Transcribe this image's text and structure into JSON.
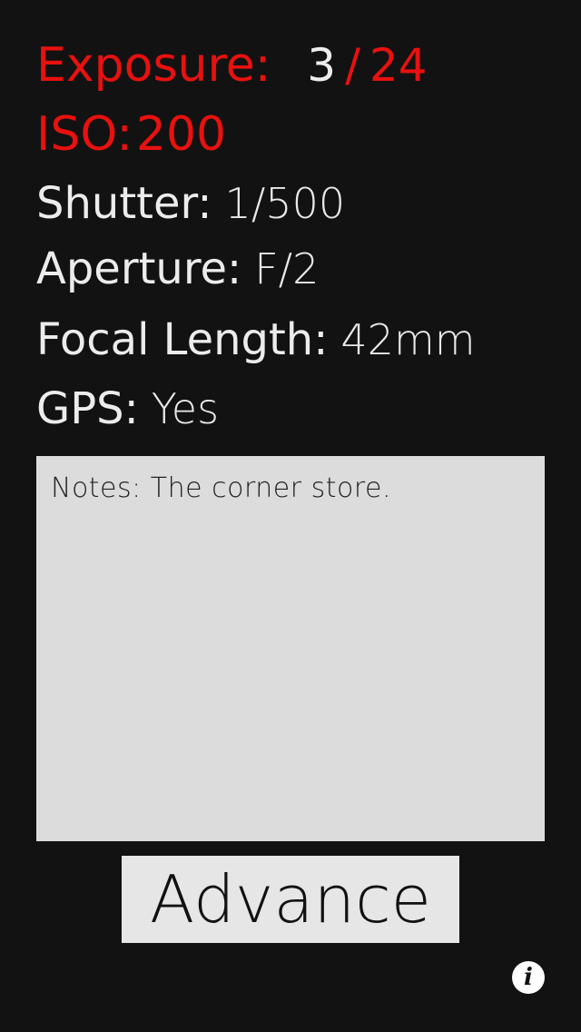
{
  "exposure": {
    "label": "Exposure:",
    "current": "3",
    "separator": "/",
    "total": "24"
  },
  "iso": {
    "label": "ISO:",
    "value": "200"
  },
  "shutter": {
    "label": "Shutter:",
    "value": "1/500"
  },
  "aperture": {
    "label": "Aperture:",
    "value": "F/2"
  },
  "focal_length": {
    "label": "Focal Length:",
    "value": "42mm"
  },
  "gps": {
    "label": "GPS:",
    "value": "Yes"
  },
  "notes": {
    "text": "Notes: The corner store."
  },
  "advance_button": {
    "label": "Advance"
  },
  "info_button": {
    "icon": "info-icon",
    "glyph": "i"
  },
  "colors": {
    "background": "#121212",
    "accent_red": "#e8110f",
    "text_light": "#ececec",
    "panel": "#dcdcdc"
  }
}
